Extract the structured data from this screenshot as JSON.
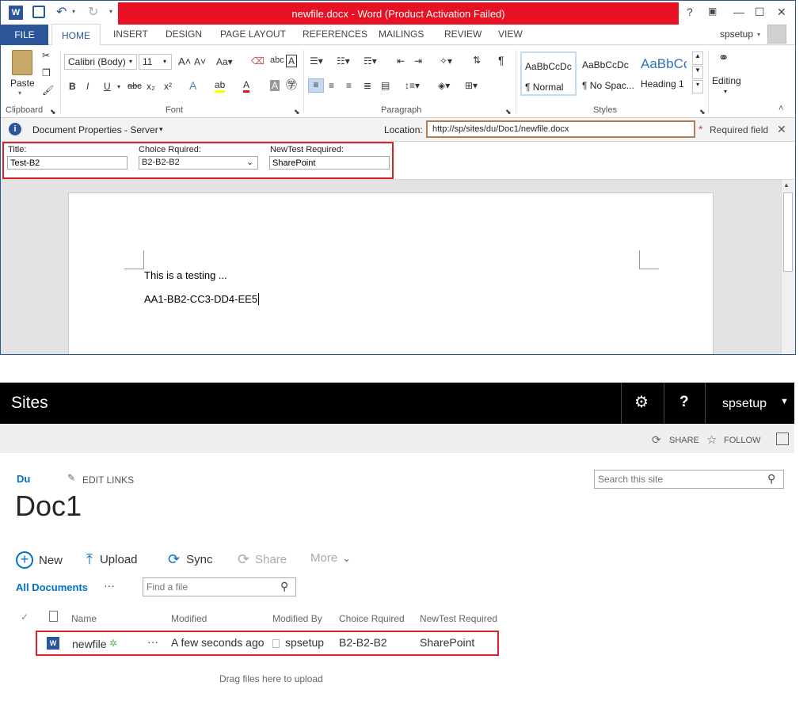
{
  "word": {
    "title": "newfile.docx - Word (Product Activation Failed)",
    "window_buttons": [
      "?",
      "▣",
      "—",
      "☐",
      "✕"
    ],
    "tabs": [
      "FILE",
      "HOME",
      "INSERT",
      "DESIGN",
      "PAGE LAYOUT",
      "REFERENCES",
      "MAILINGS",
      "REVIEW",
      "VIEW"
    ],
    "user": "spsetup",
    "ribbon": {
      "clipboard_label": "Clipboard",
      "paste_label": "Paste",
      "font_label": "Font",
      "font_name": "Calibri (Body)",
      "font_size": "11",
      "paragraph_label": "Paragraph",
      "styles_label": "Styles",
      "styles": [
        {
          "preview": "AaBbCcDc",
          "name": "¶ Normal"
        },
        {
          "preview": "AaBbCcDc",
          "name": "¶ No Spac..."
        },
        {
          "preview": "AaBbCc",
          "name": "Heading 1"
        }
      ],
      "editing_label": "Editing"
    },
    "docprops": {
      "title": "Document Properties - Server",
      "location_label": "Location:",
      "location_value": "http://sp/sites/du/Doc1/newfile.docx",
      "required_label": "Required field"
    },
    "fields": {
      "title_label": "Title:",
      "title_value": "Test-B2",
      "choice_label": "Choice Rquired:",
      "choice_value": "B2-B2-B2",
      "newtest_label": "NewTest Required:",
      "newtest_value": "SharePoint"
    },
    "document": {
      "line1": "This is a testing ...",
      "line2": "AA1-BB2-CC3-DD4-EE5"
    }
  },
  "sharepoint": {
    "suite_title": "Sites",
    "user": "spsetup",
    "share_label": "SHARE",
    "follow_label": "FOLLOW",
    "breadcrumb": "Du",
    "edit_links": "EDIT LINKS",
    "search_placeholder": "Search this site",
    "page_title": "Doc1",
    "commands": {
      "new": "New",
      "upload": "Upload",
      "sync": "Sync",
      "share": "Share",
      "more": "More"
    },
    "view_name": "All Documents",
    "find_placeholder": "Find a file",
    "columns": [
      "Name",
      "Modified",
      "Modified By",
      "Choice Rquired",
      "NewTest Required"
    ],
    "row": {
      "name": "newfile",
      "modified": "A few seconds ago",
      "modified_by": "spsetup",
      "choice": "B2-B2-B2",
      "newtest": "SharePoint"
    },
    "drag_hint": "Drag files here to upload"
  }
}
